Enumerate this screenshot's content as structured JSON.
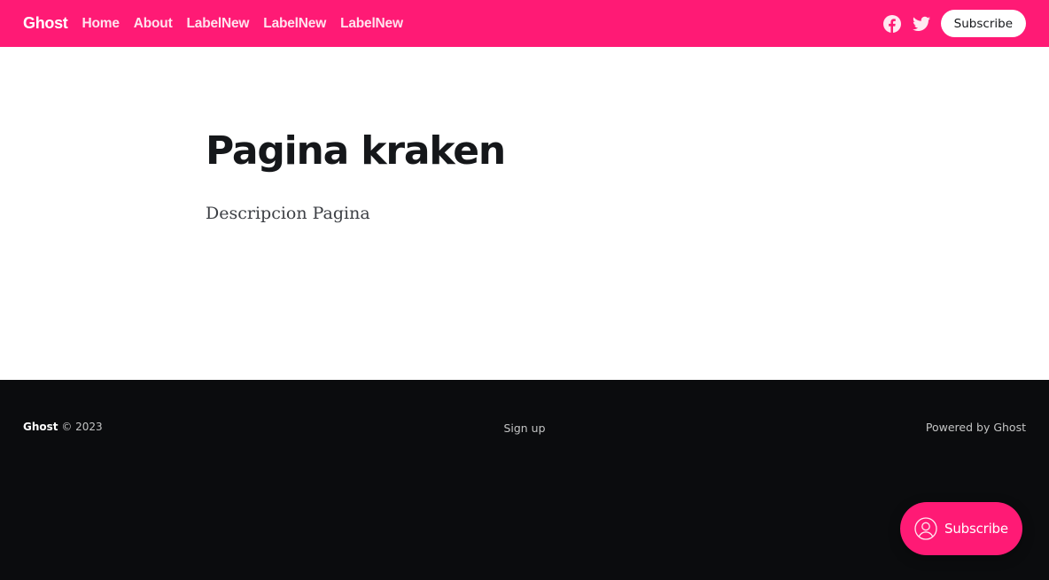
{
  "header": {
    "logo": "Ghost",
    "nav": [
      "Home",
      "About",
      "LabelNew",
      "LabelNew",
      "LabelNew"
    ],
    "social": [
      "facebook-icon",
      "twitter-icon"
    ],
    "subscribe_label": "Subscribe"
  },
  "main": {
    "title": "Pagina kraken",
    "description": "Descripcion Pagina"
  },
  "footer": {
    "brand": "Ghost",
    "copyright": " © 2023",
    "signup": "Sign up",
    "powered_by": "Powered by Ghost"
  },
  "portal": {
    "label": "Subscribe",
    "icon": "user-icon"
  },
  "colors": {
    "accent": "#ff1a75",
    "footer_bg": "#0b0c0e",
    "text_dark": "#15171a"
  }
}
